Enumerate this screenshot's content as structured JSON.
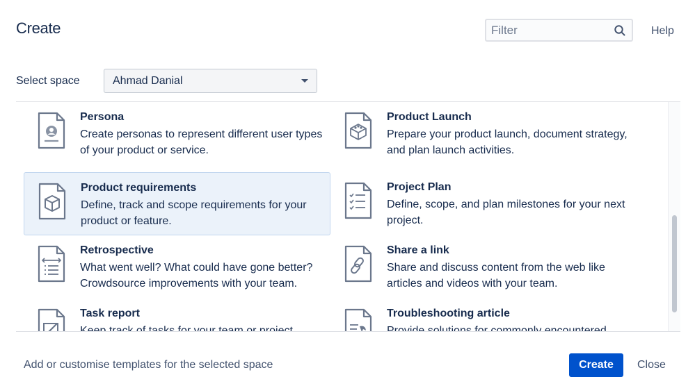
{
  "dialog": {
    "title": "Create",
    "help_label": "Help"
  },
  "filter": {
    "placeholder": "Filter"
  },
  "space": {
    "label": "Select space",
    "selected": "Ahmad Danial"
  },
  "templates": [
    {
      "name": "Persona",
      "description": "Create personas to represent different user types of your product or service.",
      "icon": "persona-icon",
      "selected": false
    },
    {
      "name": "Product Launch",
      "description": "Prepare your product launch, document strategy, and plan launch activities.",
      "icon": "product-launch-icon",
      "selected": false
    },
    {
      "name": "Product requirements",
      "description": "Define, track and scope requirements for your product or feature.",
      "icon": "product-requirements-icon",
      "selected": true
    },
    {
      "name": "Project Plan",
      "description": "Define, scope, and plan milestones for your next project.",
      "icon": "project-plan-icon",
      "selected": false
    },
    {
      "name": "Retrospective",
      "description": "What went well? What could have gone better? Crowdsource improvements with your team.",
      "icon": "retrospective-icon",
      "selected": false
    },
    {
      "name": "Share a link",
      "description": "Share and discuss content from the web like articles and videos with your team.",
      "icon": "share-link-icon",
      "selected": false
    },
    {
      "name": "Task report",
      "description": "Keep track of tasks for your team or project.",
      "icon": "task-report-icon",
      "selected": false
    },
    {
      "name": "Troubleshooting article",
      "description": "Provide solutions for commonly encountered problems.",
      "icon": "troubleshooting-article-icon",
      "selected": false
    }
  ],
  "footer": {
    "customise_link": "Add or customise templates for the selected space",
    "create_label": "Create",
    "close_label": "Close"
  },
  "colors": {
    "primary": "#0052cc",
    "selected_bg": "#ebf2fa",
    "text": "#172b4d",
    "subtle_text": "#42526e"
  }
}
